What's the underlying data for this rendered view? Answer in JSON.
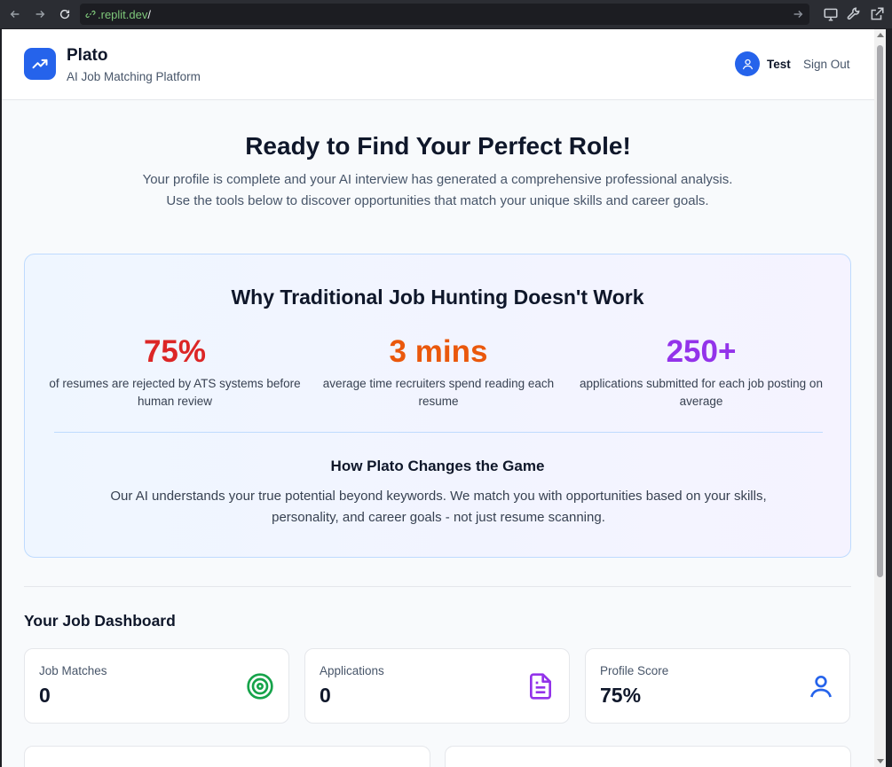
{
  "browser": {
    "url_domain": ".replit.dev",
    "url_path": "/"
  },
  "header": {
    "brand_title": "Plato",
    "brand_subtitle": "AI Job Matching Platform",
    "user_name": "Test",
    "sign_out_label": "Sign Out"
  },
  "hero": {
    "title": "Ready to Find Your Perfect Role!",
    "description": "Your profile is complete and your AI interview has generated a comprehensive professional analysis. Use the tools below to discover opportunities that match your unique skills and career goals."
  },
  "why": {
    "title": "Why Traditional Job Hunting Doesn't Work",
    "stats": [
      {
        "value": "75%",
        "description": "of resumes are rejected by ATS systems before human review",
        "color": "#dc2626"
      },
      {
        "value": "3 mins",
        "description": "average time recruiters spend reading each resume",
        "color": "#ea580c"
      },
      {
        "value": "250+",
        "description": "applications submitted for each job posting on average",
        "color": "#9333ea"
      }
    ],
    "how_title": "How Plato Changes the Game",
    "how_description": "Our AI understands your true potential beyond keywords. We match you with opportunities based on your skills, personality, and career goals - not just resume scanning."
  },
  "dashboard": {
    "title": "Your Job Dashboard",
    "cards": [
      {
        "label": "Job Matches",
        "value": "0",
        "icon": "target-icon",
        "icon_color": "#16a34a"
      },
      {
        "label": "Applications",
        "value": "0",
        "icon": "document-icon",
        "icon_color": "#9333ea"
      },
      {
        "label": "Profile Score",
        "value": "75%",
        "icon": "user-icon",
        "icon_color": "#2563eb"
      }
    ]
  },
  "colors": {
    "brand": "#2563eb",
    "page_bg": "#f8fafc"
  }
}
